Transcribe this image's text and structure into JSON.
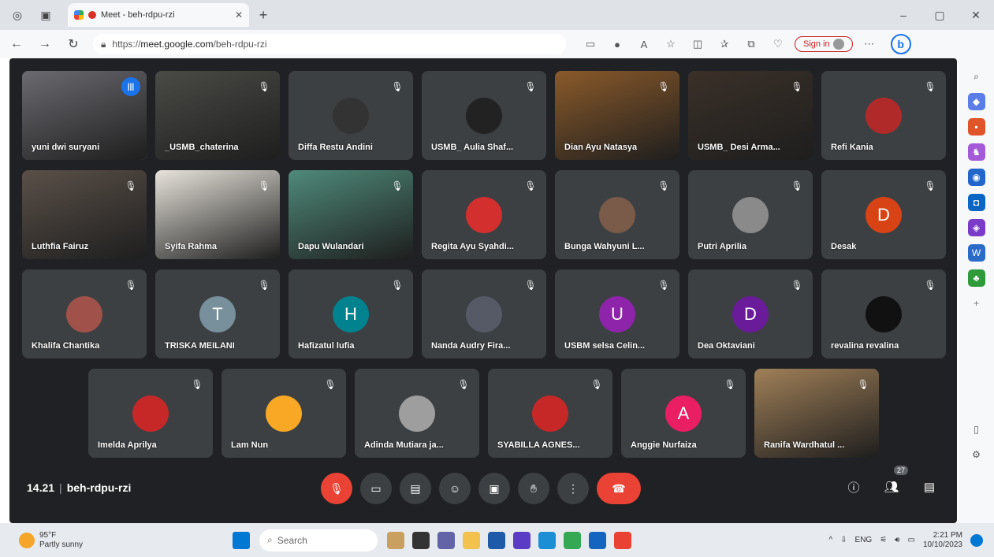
{
  "browser": {
    "tab_title": "Meet - beh-rdpu-rzi",
    "url_scheme": "https://",
    "url_host": "meet.google.com",
    "url_path": "/beh-rdpu-rzi",
    "signin_label": "Sign in"
  },
  "meeting": {
    "time": "14.21",
    "code": "beh-rdpu-rzi",
    "people_count": "27"
  },
  "participants": [
    {
      "name": "yuni dwi suryani",
      "kind": "photo",
      "bg": "#6b6a70",
      "speaking": true
    },
    {
      "name": "_USMB_chaterina",
      "kind": "photo",
      "bg": "#4a4a46"
    },
    {
      "name": "Diffa Restu Andini",
      "kind": "avatar",
      "color": "#333333"
    },
    {
      "name": "USMB_ Aulia Shaf...",
      "kind": "avatar",
      "color": "#222222"
    },
    {
      "name": "Dian Ayu Natasya",
      "kind": "photo",
      "bg": "#8a5a2a"
    },
    {
      "name": "USMB_ Desi Arma...",
      "kind": "photo",
      "bg": "#3a3028"
    },
    {
      "name": "Refi Kania",
      "kind": "avatar",
      "color": "#b02a2a"
    },
    {
      "name": "Luthfia Fairuz",
      "kind": "photo",
      "bg": "#5a5048"
    },
    {
      "name": "Syifa Rahma",
      "kind": "photo",
      "bg": "#e8e4dc"
    },
    {
      "name": "Dapu Wulandari",
      "kind": "photo",
      "bg": "#4f8a7a"
    },
    {
      "name": "Regita Ayu Syahdi...",
      "kind": "avatar",
      "color": "#d32f2f"
    },
    {
      "name": "Bunga Wahyuni L...",
      "kind": "avatar",
      "color": "#7a5a48"
    },
    {
      "name": "Putri Aprilia",
      "kind": "avatar",
      "color": "#8a8a8a"
    },
    {
      "name": "Desak",
      "kind": "letter",
      "letter": "D",
      "color": "#d84315"
    },
    {
      "name": "Khalifa Chantika",
      "kind": "avatar",
      "color": "#a0524a"
    },
    {
      "name": "TRISKA MEILANI",
      "kind": "letter",
      "letter": "T",
      "color": "#78909c"
    },
    {
      "name": "Hafizatul lufia",
      "kind": "letter",
      "letter": "H",
      "color": "#00838f"
    },
    {
      "name": "Nanda Audry Fira...",
      "kind": "avatar",
      "color": "#555a66"
    },
    {
      "name": "USBM selsa Celin...",
      "kind": "letter",
      "letter": "U",
      "color": "#8e24aa"
    },
    {
      "name": "Dea Oktaviani",
      "kind": "letter",
      "letter": "D",
      "color": "#6a1b9a"
    },
    {
      "name": "revalina revalina",
      "kind": "avatar",
      "color": "#111111"
    },
    {
      "name": "Imelda Aprilya",
      "kind": "avatar",
      "color": "#c62828"
    },
    {
      "name": "Lam Nun",
      "kind": "avatar",
      "color": "#f9a825"
    },
    {
      "name": "Adinda Mutiara ja...",
      "kind": "avatar",
      "color": "#9e9e9e"
    },
    {
      "name": "SYABILLA AGNES...",
      "kind": "avatar",
      "color": "#c62828"
    },
    {
      "name": "Anggie Nurfaiza",
      "kind": "letter",
      "letter": "A",
      "color": "#e91e63"
    },
    {
      "name": "Ranifa Wardhatul ...",
      "kind": "photo",
      "bg": "#a08058"
    }
  ],
  "taskbar": {
    "temp": "95°F",
    "condition": "Partly sunny",
    "search_placeholder": "Search",
    "lang": "ENG",
    "time": "2:21 PM",
    "date": "10/10/2023"
  },
  "colors": {
    "meet_bg": "#202124",
    "tile_bg": "#3c4043",
    "end_call": "#ea4335",
    "active_border": "#8ab4f8"
  }
}
